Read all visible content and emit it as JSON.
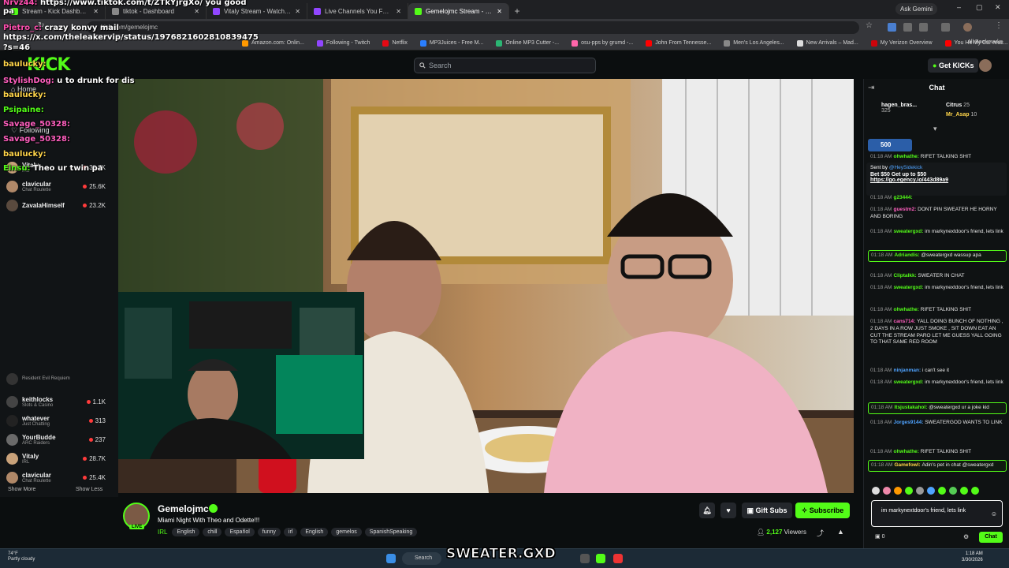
{
  "browser": {
    "tabs": [
      {
        "label": "Stream - Kick Dashboard",
        "color": "#53fc18"
      },
      {
        "label": "tiktok - Dashboard",
        "color": "#888888"
      },
      {
        "label": "Vitaly Stream - Watch Live on Kick",
        "color": "#9146ff"
      },
      {
        "label": "Live Channels You Follow - Twitch",
        "color": "#9146ff"
      },
      {
        "label": "Gemelojmc Stream - Watch",
        "color": "#53fc18"
      }
    ],
    "new_tab": "+",
    "ask_gemini": "Ask Gemini",
    "url": "kick.com/gemelojmc",
    "bookmarks": [
      {
        "label": "Amazon.com: Onlin...",
        "color": "#ff9900"
      },
      {
        "label": "Following - Twitch",
        "color": "#9146ff"
      },
      {
        "label": "Netflix",
        "color": "#e50914"
      },
      {
        "label": "MP3Juices - Free M...",
        "color": "#2a7fff"
      },
      {
        "label": "Online MP3 Cutter -...",
        "color": "#2bb673"
      },
      {
        "label": "osu-pps by grumd -...",
        "color": "#ff66aa"
      },
      {
        "label": "John From Tennesse...",
        "color": "#ff0000"
      },
      {
        "label": "Men's Los Angeles...",
        "color": "#888888"
      },
      {
        "label": "New Arrivals – Mad...",
        "color": "#dddddd"
      },
      {
        "label": "My Verizon Overview",
        "color": "#cd040b"
      },
      {
        "label": "You Hit My Car reac...",
        "color": "#ff0000"
      }
    ],
    "all_bookmarks": "All Bookmarks"
  },
  "overlay_top": [
    {
      "user": "Nrvz44:",
      "text": "https://www.tiktok.com/t/ZTkYjrgXo/ you good"
    },
    {
      "user": "",
      "text": "pa"
    },
    {
      "user": "Pietro_c:",
      "text": "crazy konvy mail"
    },
    {
      "user": "",
      "text": "https://x.com/theleakervip/status/1976821602810839475"
    },
    {
      "user": "",
      "text": "?s=46"
    }
  ],
  "kick": {
    "logo": "KICK",
    "search_placeholder": "Search",
    "get_kicks": "Get KICKs"
  },
  "overlay_chat": [
    {
      "user": "baulucky:",
      "text": ""
    },
    {
      "user": "StylishDog:",
      "text": "u to drunk for dis"
    },
    {
      "user": "baulucky:",
      "text": ""
    },
    {
      "user": "Psipaine:",
      "text": ""
    },
    {
      "user": "Savage_50328:",
      "text": ""
    },
    {
      "user": "Savage_50328:",
      "text": ""
    },
    {
      "user": "baulucky:",
      "text": ""
    },
    {
      "user": "Einsu:",
      "text": "Theo ur twin pa"
    }
  ],
  "sidebar": {
    "home": "Home",
    "following": "Following",
    "top_channels": [
      {
        "name": "Vitaly",
        "category": "IRL",
        "viewers": "30.7K",
        "color": "#c9a27a"
      },
      {
        "name": "clavicular",
        "category": "Chat Roulette",
        "viewers": "25.6K",
        "color": "#b08868"
      },
      {
        "name": "ZavalaHimself",
        "category": "",
        "viewers": "23.2K",
        "color": "#5a4a3e"
      }
    ],
    "bottom_channels": [
      {
        "name": "",
        "category": "Resident Evil Requiem",
        "viewers": "",
        "color": "#333333"
      },
      {
        "name": "keithlocks",
        "category": "Slots & Casino",
        "viewers": "1.1K",
        "color": "#444444"
      },
      {
        "name": "whatever",
        "category": "Just Chatting",
        "viewers": "313",
        "color": "#222222"
      },
      {
        "name": "YourBudde",
        "category": "ARC Raiders",
        "viewers": "237",
        "color": "#6a6a6a"
      },
      {
        "name": "Vitaly",
        "category": "IRL",
        "viewers": "28.7K",
        "color": "#c9a27a"
      },
      {
        "name": "clavicular",
        "category": "Chat Roulette",
        "viewers": "25.4K",
        "color": "#b08868"
      }
    ],
    "show_more": "Show More",
    "show_less": "Show Less"
  },
  "stream": {
    "name": "Gemelojmc",
    "live": "LIVE",
    "title": "Miami Night With Theo and Odette!!!",
    "category": "IRL",
    "tags": [
      "English",
      "chill",
      "Español",
      "funny",
      "irl",
      "English",
      "gemelos",
      "SpanishSpeaking"
    ],
    "gift_subs": "Gift Subs",
    "subscribe": "Subscribe",
    "viewers": "2,127",
    "viewers_label": "Viewers"
  },
  "chat": {
    "title": "Chat",
    "gifters": [
      {
        "name": "hagen_bras...",
        "count": "325"
      },
      {
        "name": "Citrus",
        "count": "25"
      },
      {
        "name": "Mr_Asap",
        "count": "10"
      }
    ],
    "kick_points": "500",
    "pinned": {
      "sent_by": "Sent by",
      "sender": "@HeySidekick",
      "line1": "Bet $50 Get up to $50",
      "link": "https://go.egency.io/443d89a9"
    },
    "messages": [
      {
        "time": "01:18 AM",
        "user": "ohwhathe:",
        "text": "RIFET TALKING SHIT",
        "color": "#53fc18",
        "hl": false
      },
      {
        "time": "01:18 AM",
        "user": "g23444:",
        "text": "",
        "color": "#53fc18",
        "hl": false
      },
      {
        "time": "01:18 AM",
        "user": "guestm2:",
        "text": "DONT PIN SWEATER HE HORNY AND BORING",
        "color": "#ff5fbf",
        "hl": false
      },
      {
        "time": "01:18 AM",
        "user": "sweatergxd:",
        "text": "im markynextdoor's friend, lets link",
        "color": "#53fc18",
        "hl": false
      },
      {
        "time": "01:18 AM",
        "user": "Adriandis:",
        "text": "@sweatergxd wassup apa",
        "color": "#53fc18",
        "hl": true
      },
      {
        "time": "01:18 AM",
        "user": "Cliptalkk:",
        "text": "SWEATER IN CHAT",
        "color": "#53fc18",
        "hl": false
      },
      {
        "time": "01:18 AM",
        "user": "sweatergxd:",
        "text": "im markynextdoor's friend, lets link",
        "color": "#53fc18",
        "hl": false
      },
      {
        "time": "01:18 AM",
        "user": "ohwhathe:",
        "text": "RIFET TALKING SHIT",
        "color": "#53fc18",
        "hl": false
      },
      {
        "time": "01:18 AM",
        "user": "cans714:",
        "text": "YALL DOING BUNCH OF NOTHING , 2 DAYS IN A ROW JUST SMOKE , SIT DOWN EAT AN CUT THE STREAM PARO LET ME GUESS YALL GOING TO THAT SAME RED ROOM",
        "color": "#ff5fbf",
        "hl": false
      },
      {
        "time": "01:18 AM",
        "user": "ninjanman:",
        "text": "i can't see it",
        "color": "#4fa3ff",
        "hl": false
      },
      {
        "time": "01:18 AM",
        "user": "sweatergxd:",
        "text": "im markynextdoor's friend, lets link",
        "color": "#53fc18",
        "hl": false
      },
      {
        "time": "01:18 AM",
        "user": "Itsjustakahol:",
        "text": "@sweatergxd ur a joke kid",
        "color": "#53fc18",
        "hl": true
      },
      {
        "time": "01:18 AM",
        "user": "Jorges9144:",
        "text": "SWEATERGOD WANTS TO LINK",
        "color": "#4fa3ff",
        "hl": false
      },
      {
        "time": "01:18 AM",
        "user": "ohwhathe:",
        "text": "RIFET TALKING SHIT",
        "color": "#53fc18",
        "hl": false
      },
      {
        "time": "01:18 AM",
        "user": "Gamefowl:",
        "text": "Adin's pet in chat @sweatergxd",
        "color": "#ffd54a",
        "hl": true
      }
    ],
    "input_value": "im markynextdoor's friend, lets link",
    "points": "0",
    "send": "Chat"
  },
  "taskbar": {
    "temp": "74°F",
    "weather": "Partly cloudy",
    "search": "Search",
    "banner": "SWEATER.GXD",
    "time": "1:18 AM",
    "date": "3/30/2026"
  }
}
